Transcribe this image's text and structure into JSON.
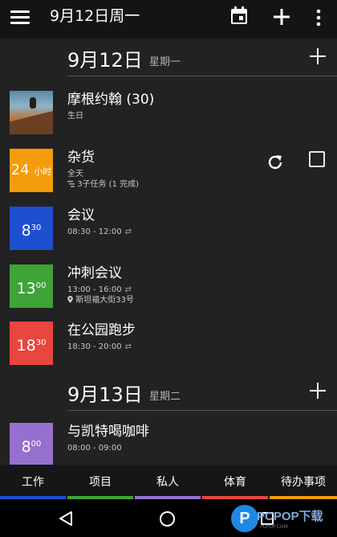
{
  "topbar": {
    "title": "9月12日周一",
    "menu_icon": "hamburger-menu-icon",
    "calendar_icon": "calendar-today-icon",
    "add_icon": "plus-icon",
    "more_icon": "more-vertical-icon"
  },
  "days": [
    {
      "date": "9月12日",
      "weekday": "星期一",
      "events": [
        {
          "tile_kind": "photo",
          "title": "摩根约翰 (30)",
          "line1": "生日"
        },
        {
          "tile_kind": "allday",
          "tile_main": "24",
          "tile_small": "小时",
          "tile_color": "#f49c0c",
          "title": "杂货",
          "line1": "全天",
          "line2": "3子任务 (1 完成)"
        },
        {
          "tile_kind": "time",
          "tile_hour": "8",
          "tile_min": "30",
          "tile_color": "#1e4fd1",
          "title": "会议",
          "line1": "08:30 - 12:00"
        },
        {
          "tile_kind": "time",
          "tile_hour": "13",
          "tile_min": "00",
          "tile_color": "#3fa338",
          "title": "冲刺会议",
          "line1": "13:00 - 16:00",
          "line2": "斯坦福大街33号"
        },
        {
          "tile_kind": "time",
          "tile_hour": "18",
          "tile_min": "30",
          "tile_color": "#e8463e",
          "title": "在公园跑步",
          "line1": "18:30 - 20:00"
        }
      ]
    },
    {
      "date": "9月13日",
      "weekday": "星期二",
      "events": [
        {
          "tile_kind": "time",
          "tile_hour": "8",
          "tile_min": "00",
          "tile_color": "#9670cf",
          "title": "与凯特喝咖啡",
          "line1": "08:00 - 09:00"
        }
      ]
    }
  ],
  "tabs": [
    {
      "label": "工作",
      "color": "#1e4fd1"
    },
    {
      "label": "项目",
      "color": "#3fa338"
    },
    {
      "label": "私人",
      "color": "#9670cf"
    },
    {
      "label": "体育",
      "color": "#e8463e"
    },
    {
      "label": "待办事项",
      "color": "#f49c0c"
    }
  ],
  "navbar": {
    "back_icon": "back-triangle-icon",
    "home_icon": "home-circle-icon",
    "recent_icon": "recent-apps-square-icon"
  },
  "watermark": {
    "logo_letter": "P",
    "text": "PCPOP下载",
    "sub": "PCPOP.COM"
  },
  "colors": {
    "background": "#222222",
    "topbar": "#141414",
    "divider": "#555555"
  }
}
